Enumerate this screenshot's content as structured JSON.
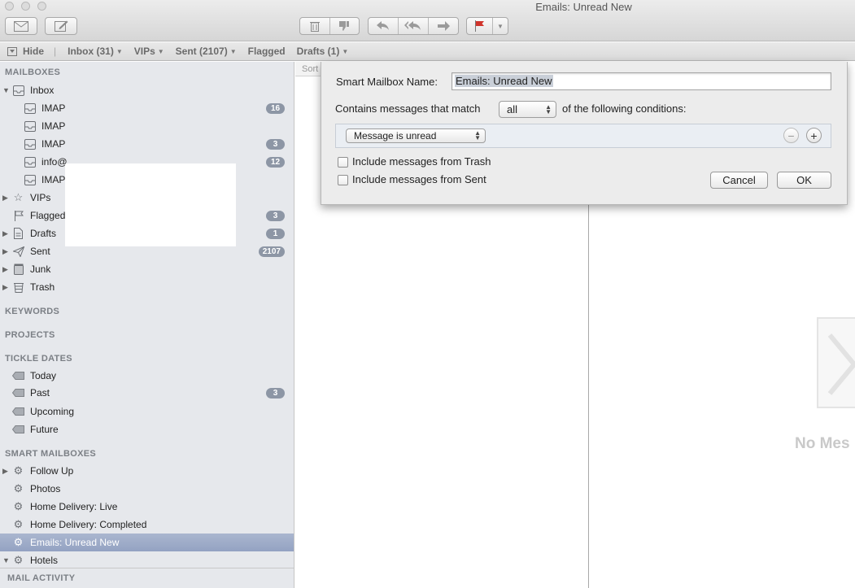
{
  "window": {
    "title": "Emails: Unread New"
  },
  "toolbar": {
    "get_mail_icon": "envelope-icon",
    "compose_icon": "compose-icon",
    "delete_icon": "trash-icon",
    "junk_icon": "thumbs-down-icon",
    "reply_icon": "reply-icon",
    "reply_all_icon": "reply-all-icon",
    "forward_icon": "forward-icon",
    "flag_icon": "flag-icon",
    "flag_color": "#d0342c"
  },
  "favorites": {
    "hide_label": "Hide",
    "items": [
      {
        "label": "Inbox (31)"
      },
      {
        "label": "VIPs"
      },
      {
        "label": "Sent (2107)"
      },
      {
        "label": "Flagged"
      },
      {
        "label": "Drafts (1)"
      }
    ]
  },
  "sidebar": {
    "mailboxes_header": "MAILBOXES",
    "inbox": {
      "label": "Inbox"
    },
    "accounts": [
      {
        "label": "IMAP",
        "count": "16"
      },
      {
        "label": "IMAP",
        "count": ""
      },
      {
        "label": "IMAP",
        "count": "3"
      },
      {
        "label": "info@",
        "count": "12"
      },
      {
        "label": "IMAP",
        "count": ""
      }
    ],
    "vips": {
      "label": "VIPs"
    },
    "flagged": {
      "label": "Flagged",
      "count": "3"
    },
    "drafts": {
      "label": "Drafts",
      "count": "1"
    },
    "sent": {
      "label": "Sent",
      "count": "2107"
    },
    "junk": {
      "label": "Junk"
    },
    "trash": {
      "label": "Trash"
    },
    "keywords_header": "KEYWORDS",
    "projects_header": "PROJECTS",
    "tickle_header": "TICKLE DATES",
    "tickle": [
      {
        "label": "Today",
        "count": ""
      },
      {
        "label": "Past",
        "count": "3"
      },
      {
        "label": "Upcoming",
        "count": ""
      },
      {
        "label": "Future",
        "count": ""
      }
    ],
    "smart_header": "SMART MAILBOXES",
    "smart": [
      {
        "label": "Follow Up"
      },
      {
        "label": "Photos"
      },
      {
        "label": "Home Delivery: Live"
      },
      {
        "label": "Home Delivery: Completed"
      },
      {
        "label": "Emails: Unread New"
      },
      {
        "label": "Hotels"
      }
    ],
    "activity_header": "MAIL ACTIVITY"
  },
  "message_list": {
    "sort_label": "Sort"
  },
  "preview": {
    "empty_text": "No Mes"
  },
  "dialog": {
    "name_label": "Smart Mailbox Name:",
    "name_value": "Emails: Unread New",
    "contains_label": "Contains messages that match",
    "match_value": "all",
    "following_label": "of the following conditions:",
    "condition_value": "Message is unread",
    "include_trash_label": "Include messages from Trash",
    "include_sent_label": "Include messages from Sent",
    "cancel_label": "Cancel",
    "ok_label": "OK"
  }
}
